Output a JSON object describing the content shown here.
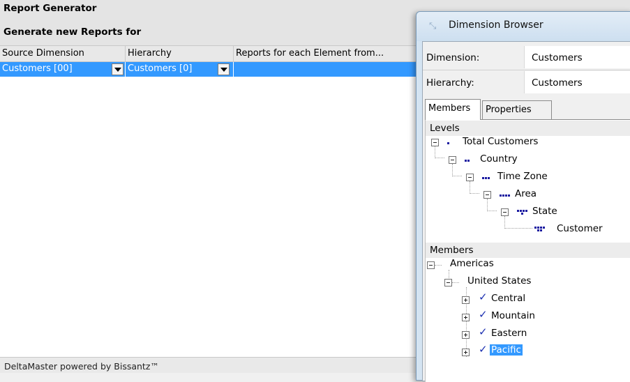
{
  "report_generator": {
    "title": "Report Generator",
    "subtitle": "Generate new Reports for",
    "columns": [
      "Source Dimension",
      "Hierarchy",
      "Reports for each Element from..."
    ],
    "row": {
      "source_dimension": "Customers [00]",
      "hierarchy": "Customers [0]"
    },
    "status": "DeltaMaster powered by Bissantz™"
  },
  "dimension_browser": {
    "title": "Dimension Browser",
    "dimension_label": "Dimension:",
    "dimension_value": "Customers",
    "hierarchy_label": "Hierarchy:",
    "hierarchy_value": "Customers",
    "tabs": [
      "Members",
      "Properties"
    ],
    "levels_header": "Levels",
    "levels": [
      "Total Customers",
      "Country",
      "Time Zone",
      "Area",
      "State",
      "Customer"
    ],
    "members_header": "Members",
    "members": {
      "root": "Americas",
      "child": "United States",
      "leaves": [
        "Central",
        "Mountain",
        "Eastern",
        "Pacific"
      ],
      "selected": "Pacific"
    }
  },
  "colors": {
    "selection": "#3399ff",
    "header_bg": "#e4e4e4",
    "level_icon": "#1a1aa0",
    "check": "#1b2fb0"
  }
}
